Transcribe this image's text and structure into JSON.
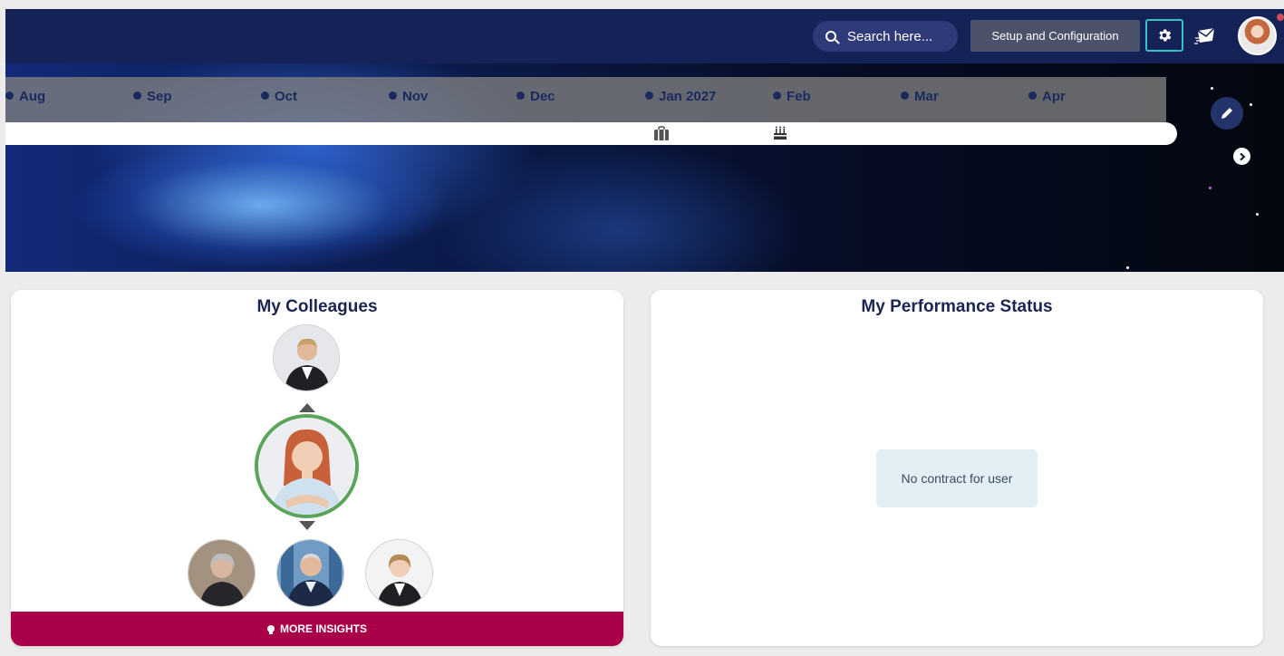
{
  "header": {
    "search_placeholder": "Search here...",
    "tooltip": "Setup and Configuration",
    "icons": [
      "search-icon",
      "gear-icon",
      "mail-icon",
      "avatar"
    ]
  },
  "timeline": {
    "months": [
      "Aug",
      "Sep",
      "Oct",
      "Nov",
      "Dec",
      "Jan 2027",
      "Feb",
      "Mar",
      "Apr"
    ],
    "icons": [
      "briefcase-icon",
      "cake-icon"
    ]
  },
  "colleagues": {
    "title": "My Colleagues",
    "insights_label": "MORE INSIGHTS"
  },
  "performance": {
    "title": "My Performance Status",
    "message": "No contract for user"
  },
  "colors": {
    "topbar": "#142257",
    "accent": "#a90049",
    "highlight_ring": "#5aa55a",
    "focus_border": "#33c1c4"
  }
}
